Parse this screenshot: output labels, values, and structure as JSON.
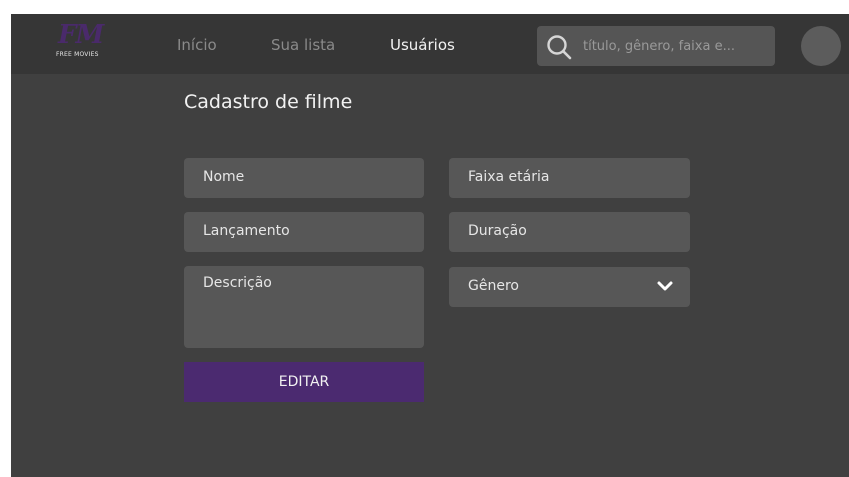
{
  "brand": {
    "logo_mark": "FM",
    "logo_text": "FREE MOVIES",
    "accent_color": "#4b2a70"
  },
  "nav": {
    "items": [
      {
        "label": "Início",
        "active": false
      },
      {
        "label": "Sua lista",
        "active": false
      },
      {
        "label": "Usuários",
        "active": true
      }
    ]
  },
  "search": {
    "placeholder": "título, gênero, faixa e...",
    "value": "",
    "icon": "search-icon"
  },
  "user": {
    "avatar_icon": "avatar"
  },
  "form": {
    "title": "Cadastro de filme",
    "fields": {
      "nome": {
        "placeholder": "Nome",
        "value": ""
      },
      "lancamento": {
        "placeholder": "Lançamento",
        "value": ""
      },
      "descricao": {
        "placeholder": "Descrição",
        "value": ""
      },
      "faixa_etaria": {
        "placeholder": "Faixa etária",
        "value": ""
      },
      "duracao": {
        "placeholder": "Duração",
        "value": ""
      },
      "genero": {
        "placeholder": "Gênero",
        "value": "",
        "icon": "chevron-down-icon"
      }
    },
    "submit_label": "EDITAR"
  }
}
